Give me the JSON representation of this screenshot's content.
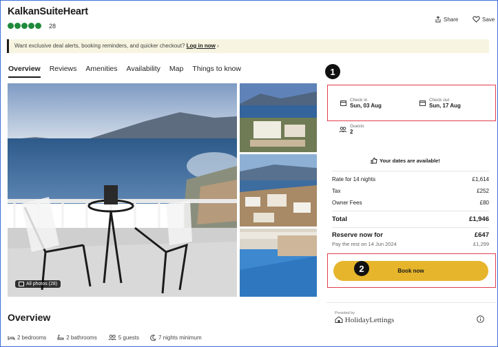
{
  "listing": {
    "title": "KalkanSuiteHeart",
    "rating_count": "28",
    "share_label": "Share",
    "save_label": "Save"
  },
  "banner": {
    "text": "Want exclusive deal alerts, booking reminders, and quicker checkout?",
    "link": "Log in now",
    "arrow": "›"
  },
  "tabs": [
    "Overview",
    "Reviews",
    "Amenities",
    "Availability",
    "Map",
    "Things to know"
  ],
  "photos": {
    "all_photos_label": "All photos (28)"
  },
  "steps": {
    "step1": "1",
    "step2": "2"
  },
  "booking": {
    "checkin_label": "Check in",
    "checkin_value": "Sun, 03 Aug",
    "checkout_label": "Check out",
    "checkout_value": "Sun, 17 Aug",
    "guests_label": "Guests",
    "guests_value": "2",
    "availability_text": "Your dates are available!",
    "rate_label": "Rate for 14 nights",
    "rate_value": "£1,614",
    "tax_label": "Tax",
    "tax_value": "£252",
    "owner_fees_label": "Owner Fees",
    "owner_fees_value": "£80",
    "total_label": "Total",
    "total_value": "£1,946",
    "reserve_label": "Reserve now for",
    "reserve_value": "£647",
    "pay_rest_label": "Pay the rest on 14 Jun 2024",
    "pay_rest_value": "£1,299",
    "book_button": "Book now"
  },
  "provider": {
    "prefix": "Provided by",
    "name": "HolidayLettings"
  },
  "overview": {
    "heading": "Overview",
    "facts": [
      "2 bedrooms",
      "2 bathrooms",
      "5 guests",
      "7 nights minimum"
    ]
  },
  "colors": {
    "accent_yellow": "#e6b52c",
    "highlight_red": "#e23b4e",
    "rating_green": "#1f8a3b"
  }
}
